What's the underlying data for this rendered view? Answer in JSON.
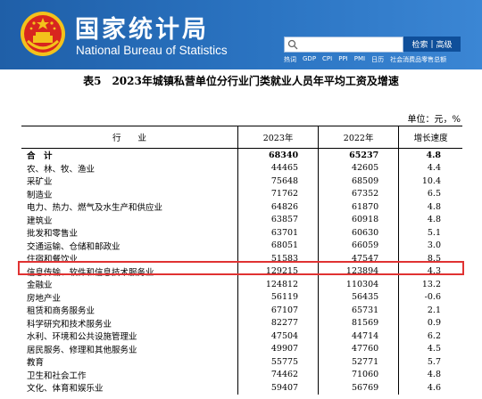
{
  "header": {
    "title_cn": "国家统计局",
    "title_en": "National Bureau of Statistics",
    "search_button": "检索",
    "advanced_search": "高级",
    "quick_links": [
      "热词",
      "GDP",
      "CPI",
      "PPI",
      "PMI",
      "日历",
      "社会消费品零售总额"
    ]
  },
  "table": {
    "title": "表5　2023年城镇私营单位分行业门类就业人员年平均工资及增速",
    "unit": "单位：元，%",
    "headers": [
      "行　　业",
      "2023年",
      "2022年",
      "增长速度"
    ],
    "rows": [
      {
        "name": "合　计",
        "y2023": "68340",
        "y2022": "65237",
        "growth": "4.8"
      },
      {
        "name": "农、林、牧、渔业",
        "y2023": "44465",
        "y2022": "42605",
        "growth": "4.4"
      },
      {
        "name": "采矿业",
        "y2023": "75648",
        "y2022": "68509",
        "growth": "10.4"
      },
      {
        "name": "制造业",
        "y2023": "71762",
        "y2022": "67352",
        "growth": "6.5"
      },
      {
        "name": "电力、热力、燃气及水生产和供应业",
        "y2023": "64826",
        "y2022": "61870",
        "growth": "4.8"
      },
      {
        "name": "建筑业",
        "y2023": "63857",
        "y2022": "60918",
        "growth": "4.8"
      },
      {
        "name": "批发和零售业",
        "y2023": "63701",
        "y2022": "60630",
        "growth": "5.1"
      },
      {
        "name": "交通运输、仓储和邮政业",
        "y2023": "68051",
        "y2022": "66059",
        "growth": "3.0"
      },
      {
        "name": "住宿和餐饮业",
        "y2023": "51583",
        "y2022": "47547",
        "growth": "8.5"
      },
      {
        "name": "信息传输、软件和信息技术服务业",
        "y2023": "129215",
        "y2022": "123894",
        "growth": "4.3"
      },
      {
        "name": "金融业",
        "y2023": "124812",
        "y2022": "110304",
        "growth": "13.2"
      },
      {
        "name": "房地产业",
        "y2023": "56119",
        "y2022": "56435",
        "growth": "-0.6"
      },
      {
        "name": "租赁和商务服务业",
        "y2023": "67107",
        "y2022": "65731",
        "growth": "2.1"
      },
      {
        "name": "科学研究和技术服务业",
        "y2023": "82277",
        "y2022": "81569",
        "growth": "0.9"
      },
      {
        "name": "水利、环境和公共设施管理业",
        "y2023": "47504",
        "y2022": "44714",
        "growth": "6.2"
      },
      {
        "name": "居民服务、修理和其他服务业",
        "y2023": "49907",
        "y2022": "47760",
        "growth": "4.5"
      },
      {
        "name": "教育",
        "y2023": "55775",
        "y2022": "52771",
        "growth": "5.7"
      },
      {
        "name": "卫生和社会工作",
        "y2023": "74462",
        "y2022": "71060",
        "growth": "4.8"
      },
      {
        "name": "文化、体育和娱乐业",
        "y2023": "59407",
        "y2022": "56769",
        "growth": "4.6"
      }
    ]
  },
  "colors": {
    "header_blue": "#2b74c2",
    "highlight_red": "#e03232",
    "emblem_red": "#d8261f",
    "emblem_gold": "#f3c21b"
  },
  "icons": {
    "emblem": "national-emblem-icon",
    "search": "search-icon"
  }
}
